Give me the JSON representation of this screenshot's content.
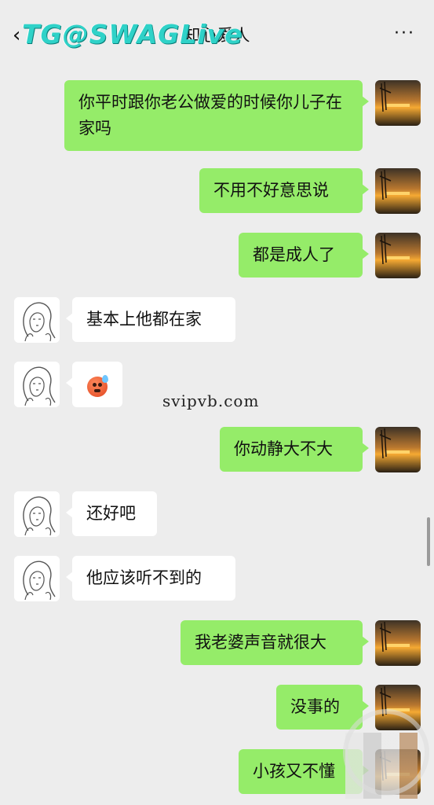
{
  "watermarks": {
    "top": "TG@SWAGLive",
    "middle": "svipvb.com"
  },
  "header": {
    "title": "知心爱人",
    "back_icon": "chevron-left-icon",
    "more_icon": "more-dots-icon",
    "back_glyph": "‹",
    "more_glyph": "···"
  },
  "colors": {
    "chat_background": "#ededed",
    "sent_bubble": "#95ec69",
    "received_bubble": "#ffffff",
    "watermark_top": "#2fd2c8"
  },
  "messages": [
    {
      "side": "sent",
      "text": "你平时跟你老公做爱的时候你儿子在家吗"
    },
    {
      "side": "sent",
      "text": "不用不好意思说"
    },
    {
      "side": "sent",
      "text": "都是成人了"
    },
    {
      "side": "received",
      "text": "基本上他都在家"
    },
    {
      "side": "received",
      "text": "",
      "emoji": "anxious-sweat-face-icon"
    },
    {
      "side": "sent",
      "text": "你动静大不大"
    },
    {
      "side": "received",
      "text": "还好吧"
    },
    {
      "side": "received",
      "text": "他应该听不到的"
    },
    {
      "side": "sent",
      "text": "我老婆声音就很大"
    },
    {
      "side": "sent",
      "text": "没事的"
    },
    {
      "side": "sent",
      "text": "小孩又不懂"
    }
  ]
}
